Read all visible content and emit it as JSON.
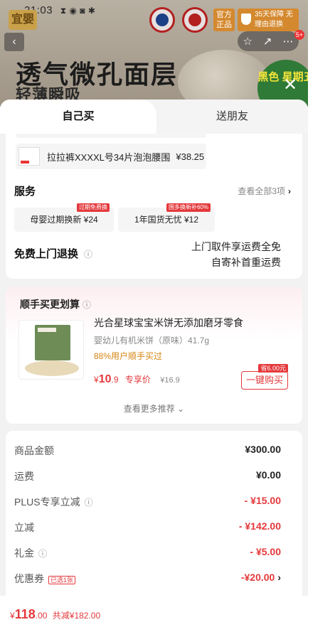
{
  "status_bar": {
    "time": "21:03",
    "icons": "⧗ ◉ ◙ ✱"
  },
  "banner": {
    "brand": "宜婴",
    "official_badge": "官方正品",
    "guarantee_badge": "35天保障 无理由退换",
    "message_count": "5+",
    "headline": "透气微孔面层",
    "subline": "轻薄瞬吸",
    "promo_circle": "黑色 星期五"
  },
  "tabs": {
    "self": "自己买",
    "friend": "送朋友"
  },
  "gift_item": {
    "name": "拉拉裤XXXXL号34片泡泡腰围",
    "price": "¥38.25"
  },
  "services": {
    "title": "服务",
    "more": "查看全部3项",
    "chips": [
      {
        "label": "母婴过期换新 ¥24",
        "tag": "过期免费换"
      },
      {
        "label": "1年国货无忧 ¥12",
        "tag": "国多换新补60%"
      }
    ]
  },
  "free_return": {
    "title": "免费上门退换",
    "line1": "上门取件享运费全免",
    "line2": "自寄补首重运费"
  },
  "recommend": {
    "title": "顺手买更划算",
    "product_name": "光合星球宝宝米饼无添加磨牙零食",
    "product_sub": "婴幼儿有机米饼（原味）41.7g",
    "rate": "88%用户顺手买过",
    "price_symbol": "¥",
    "price_int": "10",
    "price_dec": ".9",
    "exclusive": "专享价",
    "orig_price": "¥16.9",
    "save_tag": "省6.00元",
    "buy_label": "一键购买",
    "more": "查看更多推荐 ⌄"
  },
  "summary": [
    {
      "label": "商品金额",
      "value": "¥300.00",
      "red": false
    },
    {
      "label": "运费",
      "value": "¥0.00",
      "red": false
    },
    {
      "label": "PLUS专享立减",
      "value": "- ¥15.00",
      "red": true,
      "info": true
    },
    {
      "label": "立减",
      "value": "- ¥142.00",
      "red": true
    },
    {
      "label": "礼金",
      "value": "- ¥5.00",
      "red": true,
      "info": true
    },
    {
      "label": "优惠券",
      "value": "-¥20.00",
      "red": true,
      "chosen": "已选1张",
      "chevron": true
    }
  ],
  "bottom": {
    "symbol": "¥",
    "amount": "118",
    "decimals": ".00",
    "discount": "共减¥182.00"
  }
}
